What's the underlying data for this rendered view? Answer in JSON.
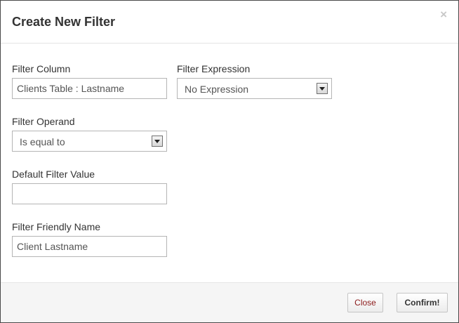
{
  "dialog": {
    "title": "Create New Filter",
    "close_glyph": "×"
  },
  "fields": {
    "filter_column": {
      "label": "Filter Column",
      "value": "Clients Table : Lastname"
    },
    "filter_expression": {
      "label": "Filter Expression",
      "selected": "No Expression"
    },
    "filter_operand": {
      "label": "Filter Operand",
      "selected": "Is equal to"
    },
    "default_filter_value": {
      "label": "Default Filter Value",
      "value": ""
    },
    "filter_friendly_name": {
      "label": "Filter Friendly Name",
      "value": "Client Lastname"
    }
  },
  "footer": {
    "close_label": "Close",
    "confirm_label": "Confirm!"
  },
  "icons": {
    "close": "close-icon",
    "dropdown": "chevron-down-icon"
  }
}
